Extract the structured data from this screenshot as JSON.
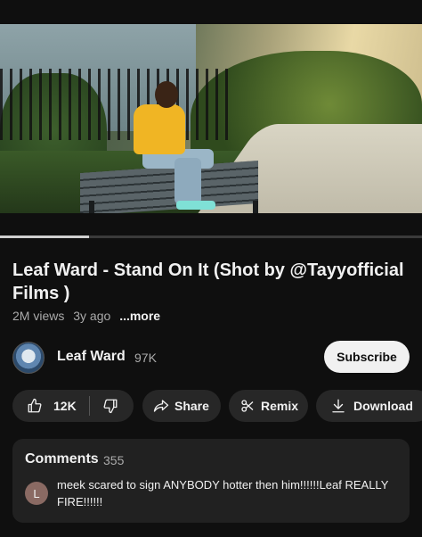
{
  "video": {
    "progress": 0.21
  },
  "title": "Leaf Ward - Stand On It (Shot by @Tayyofficial Films )",
  "meta": {
    "views": "2M views",
    "age": "3y ago",
    "more": "...more"
  },
  "channel": {
    "name": "Leaf Ward",
    "subscribers": "97K",
    "subscribe_label": "Subscribe"
  },
  "actions": {
    "likes": "12K",
    "share": "Share",
    "remix": "Remix",
    "download": "Download"
  },
  "comments": {
    "heading": "Comments",
    "count": "355",
    "top_comment": {
      "avatar_letter": "L",
      "text": "meek scared to sign ANYBODY hotter then him!!!!!!Leaf REALLY FIRE!!!!!!"
    }
  },
  "colors": {
    "background": "#0f0f0f",
    "pill": "#272727",
    "subscribe_bg": "#f1f1f1",
    "secondary_text": "#aaaaaa"
  }
}
